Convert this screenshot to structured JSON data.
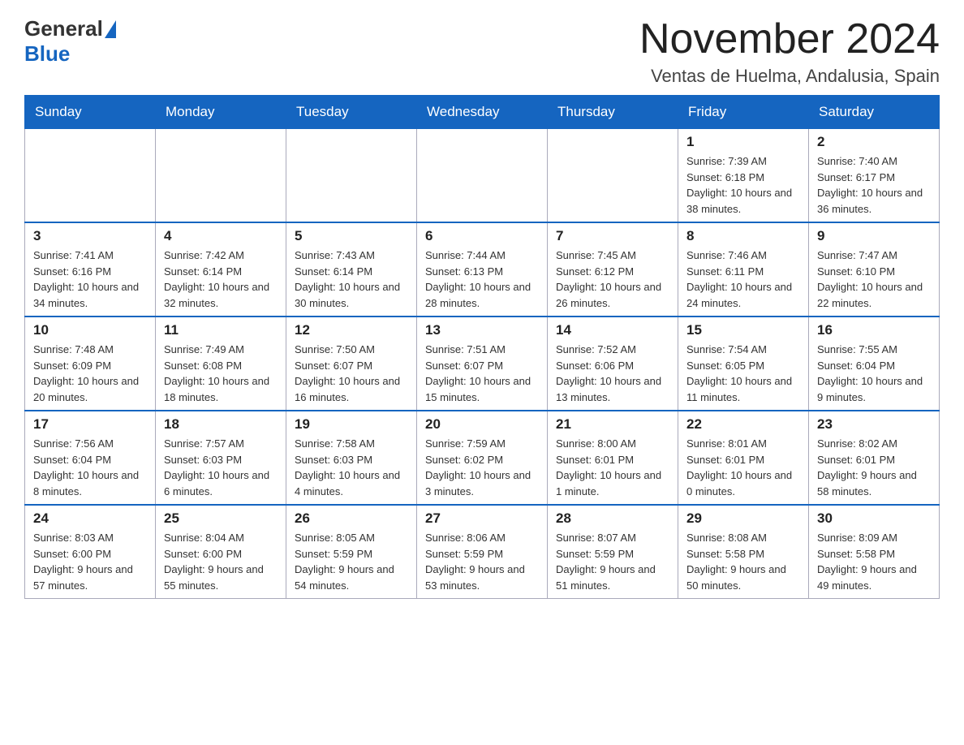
{
  "logo": {
    "general": "General",
    "blue": "Blue"
  },
  "title": "November 2024",
  "location": "Ventas de Huelma, Andalusia, Spain",
  "weekdays": [
    "Sunday",
    "Monday",
    "Tuesday",
    "Wednesday",
    "Thursday",
    "Friday",
    "Saturday"
  ],
  "weeks": [
    [
      {
        "day": "",
        "info": ""
      },
      {
        "day": "",
        "info": ""
      },
      {
        "day": "",
        "info": ""
      },
      {
        "day": "",
        "info": ""
      },
      {
        "day": "",
        "info": ""
      },
      {
        "day": "1",
        "info": "Sunrise: 7:39 AM\nSunset: 6:18 PM\nDaylight: 10 hours and 38 minutes."
      },
      {
        "day": "2",
        "info": "Sunrise: 7:40 AM\nSunset: 6:17 PM\nDaylight: 10 hours and 36 minutes."
      }
    ],
    [
      {
        "day": "3",
        "info": "Sunrise: 7:41 AM\nSunset: 6:16 PM\nDaylight: 10 hours and 34 minutes."
      },
      {
        "day": "4",
        "info": "Sunrise: 7:42 AM\nSunset: 6:14 PM\nDaylight: 10 hours and 32 minutes."
      },
      {
        "day": "5",
        "info": "Sunrise: 7:43 AM\nSunset: 6:14 PM\nDaylight: 10 hours and 30 minutes."
      },
      {
        "day": "6",
        "info": "Sunrise: 7:44 AM\nSunset: 6:13 PM\nDaylight: 10 hours and 28 minutes."
      },
      {
        "day": "7",
        "info": "Sunrise: 7:45 AM\nSunset: 6:12 PM\nDaylight: 10 hours and 26 minutes."
      },
      {
        "day": "8",
        "info": "Sunrise: 7:46 AM\nSunset: 6:11 PM\nDaylight: 10 hours and 24 minutes."
      },
      {
        "day": "9",
        "info": "Sunrise: 7:47 AM\nSunset: 6:10 PM\nDaylight: 10 hours and 22 minutes."
      }
    ],
    [
      {
        "day": "10",
        "info": "Sunrise: 7:48 AM\nSunset: 6:09 PM\nDaylight: 10 hours and 20 minutes."
      },
      {
        "day": "11",
        "info": "Sunrise: 7:49 AM\nSunset: 6:08 PM\nDaylight: 10 hours and 18 minutes."
      },
      {
        "day": "12",
        "info": "Sunrise: 7:50 AM\nSunset: 6:07 PM\nDaylight: 10 hours and 16 minutes."
      },
      {
        "day": "13",
        "info": "Sunrise: 7:51 AM\nSunset: 6:07 PM\nDaylight: 10 hours and 15 minutes."
      },
      {
        "day": "14",
        "info": "Sunrise: 7:52 AM\nSunset: 6:06 PM\nDaylight: 10 hours and 13 minutes."
      },
      {
        "day": "15",
        "info": "Sunrise: 7:54 AM\nSunset: 6:05 PM\nDaylight: 10 hours and 11 minutes."
      },
      {
        "day": "16",
        "info": "Sunrise: 7:55 AM\nSunset: 6:04 PM\nDaylight: 10 hours and 9 minutes."
      }
    ],
    [
      {
        "day": "17",
        "info": "Sunrise: 7:56 AM\nSunset: 6:04 PM\nDaylight: 10 hours and 8 minutes."
      },
      {
        "day": "18",
        "info": "Sunrise: 7:57 AM\nSunset: 6:03 PM\nDaylight: 10 hours and 6 minutes."
      },
      {
        "day": "19",
        "info": "Sunrise: 7:58 AM\nSunset: 6:03 PM\nDaylight: 10 hours and 4 minutes."
      },
      {
        "day": "20",
        "info": "Sunrise: 7:59 AM\nSunset: 6:02 PM\nDaylight: 10 hours and 3 minutes."
      },
      {
        "day": "21",
        "info": "Sunrise: 8:00 AM\nSunset: 6:01 PM\nDaylight: 10 hours and 1 minute."
      },
      {
        "day": "22",
        "info": "Sunrise: 8:01 AM\nSunset: 6:01 PM\nDaylight: 10 hours and 0 minutes."
      },
      {
        "day": "23",
        "info": "Sunrise: 8:02 AM\nSunset: 6:01 PM\nDaylight: 9 hours and 58 minutes."
      }
    ],
    [
      {
        "day": "24",
        "info": "Sunrise: 8:03 AM\nSunset: 6:00 PM\nDaylight: 9 hours and 57 minutes."
      },
      {
        "day": "25",
        "info": "Sunrise: 8:04 AM\nSunset: 6:00 PM\nDaylight: 9 hours and 55 minutes."
      },
      {
        "day": "26",
        "info": "Sunrise: 8:05 AM\nSunset: 5:59 PM\nDaylight: 9 hours and 54 minutes."
      },
      {
        "day": "27",
        "info": "Sunrise: 8:06 AM\nSunset: 5:59 PM\nDaylight: 9 hours and 53 minutes."
      },
      {
        "day": "28",
        "info": "Sunrise: 8:07 AM\nSunset: 5:59 PM\nDaylight: 9 hours and 51 minutes."
      },
      {
        "day": "29",
        "info": "Sunrise: 8:08 AM\nSunset: 5:58 PM\nDaylight: 9 hours and 50 minutes."
      },
      {
        "day": "30",
        "info": "Sunrise: 8:09 AM\nSunset: 5:58 PM\nDaylight: 9 hours and 49 minutes."
      }
    ]
  ]
}
